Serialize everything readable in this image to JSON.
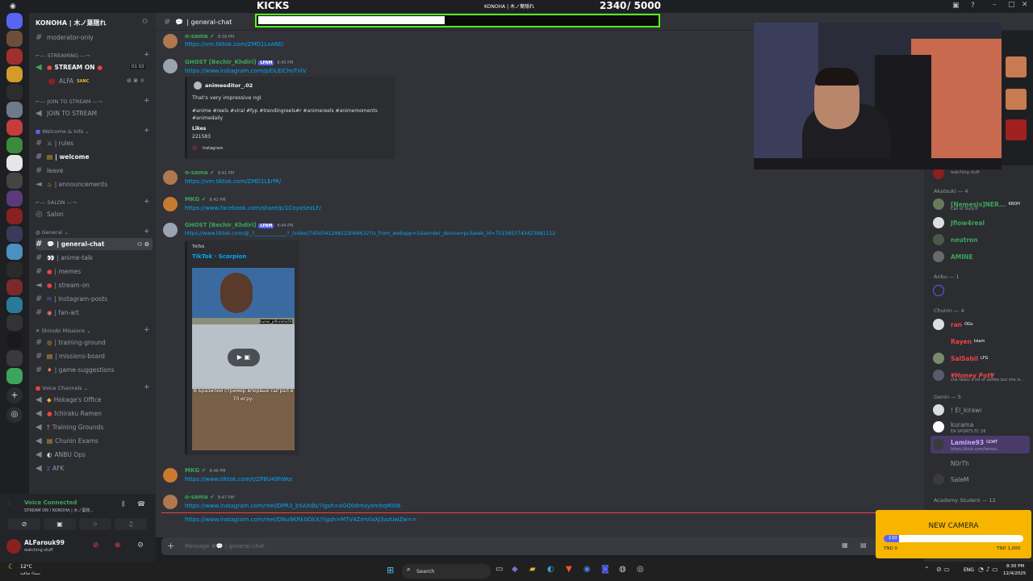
{
  "kicks_overlay": {
    "title": "KICKS",
    "server_tag": "KONOHA | 木ノ葉隠れ",
    "current": "2340",
    "goal": "/ 5000",
    "progress_fraction": 0.468
  },
  "server": {
    "name": "KONOHA | 木ノ葉隠れ"
  },
  "channels": {
    "top": "moderator-only",
    "streaming_cat": "STREAMING",
    "stream_on": "STREAM ON",
    "stream_users": "01  02",
    "stream_user": "ALFA",
    "stream_user_badge": "SANC",
    "join_cat": "JOIN TO STREAM",
    "join": "JOIN TO STREAM",
    "welcome_cat": "Welcome & Info",
    "rules": "| rules",
    "welcome": "| welcome",
    "leave": "leave",
    "announcements": "| announcements",
    "salon_cat": "SALON",
    "salon": "Salon",
    "general_cat": "General",
    "general_chat": "| general-chat",
    "anime_talk": "| anime-talk",
    "memes": "| memes",
    "stream_on_ch": "| stream-on",
    "instagram_posts": "| instagram-posts",
    "fan_art": "| fan-art",
    "shinobi_cat": "Shinobi Missions",
    "training_ground": "| training-ground",
    "missions_board": "| missions-board",
    "game_suggestions": "| game-suggestions",
    "voice_cat": "Voice Channels",
    "hokage": "Hokage's Office",
    "ichiraku": "Ichiraku Ramen",
    "training_grounds": "Training Grounds",
    "chunin_exams": "Chunin Exams",
    "anbu_ops": "ANBU Ops",
    "afk": "AFK"
  },
  "voice": {
    "status": "Voice Connected",
    "where": "STREAM ON / KONOHA | 木ノ葉隠...",
    "user": "ALFarouk99",
    "user_status": "watching stuff"
  },
  "chat": {
    "header": "| general-chat",
    "messages": [
      {
        "user": "o-sama",
        "time": "8:39 PM",
        "link": "https://vm.tiktok.com/ZMD1LxA6E/"
      },
      {
        "user": "GHOST [Bechir_Khdiri]",
        "tag": "LFAM",
        "time": "8:40 PM",
        "link": "https://www.instagram.com/p/DLEIChoTnlV"
      },
      {
        "user": "o-sama",
        "time": "8:41 PM",
        "link": "https://vm.tiktok.com/ZMD1LErfR/"
      },
      {
        "user": "MKG",
        "time": "8:42 PM",
        "link": "https://www.facebook.com/share/p/1CoyaSezLF/"
      },
      {
        "user": "GHOST [Bechir_Khdiri]",
        "tag": "LFAM",
        "time": "8:44 PM",
        "link": "https://www.tiktok.com/@_?_____________?_/video/7450541298123066632?is_from_webapp=1&sender_device=pc&web_id=7515853743423981112"
      },
      {
        "user": "MKG",
        "time": "8:46 PM",
        "link": "https://www.tiktok.com/t/ZP8U49hWo/"
      },
      {
        "user": "o-sama",
        "time": "8:47 PM",
        "link": "https://www.instagram.com/reel/DPR3_b5AXdb/?igsh=aGQ0dmxyemhqMXI6"
      },
      {
        "user": "",
        "time": "",
        "link": "https://www.instagram.com/reel/DNu9KRk0OXX/?igsh=MTV4ZmVlaXJ3azUwZw=="
      }
    ],
    "ig_embed": {
      "author": "animeeditor_.02",
      "text": "That's very impressive ngl",
      "tags": "#anime #reels #viral #fyp #trendingreels#r #animereels #animemoments #animedaily",
      "likes_label": "Likes",
      "likes": "221583",
      "source": "Instagram"
    },
    "tt_embed": {
      "provider": "TikTok",
      "title": "TikTok · Scorpion",
      "caption": "В Бразилии стример впервые сыграл в 70 игру:",
      "watermark": "humor_jefinzinho59"
    },
    "input_placeholder": "Message #💬 | general-chat"
  },
  "members": {
    "top_status": "watching stuff",
    "akatsuki_cat": "Akatsuki — 4",
    "akatsuki": [
      {
        "name": "[Nemesis]NER...",
        "status": "Call of Duty®",
        "color": "#3ba55d",
        "badge": "KRDH"
      },
      {
        "name": "Jflow4real",
        "status": "",
        "color": "#3ba55d"
      },
      {
        "name": "neutron",
        "status": "",
        "color": "#3ba55d"
      },
      {
        "name": "AMINE",
        "status": "",
        "color": "#3ba55d"
      }
    ],
    "anbu_cat": "Anbu — 1",
    "anbu": [
      {
        "name": "",
        "color": "#ed4245"
      }
    ],
    "chunin_cat": "Chunin — 4",
    "chunin": [
      {
        "name": "ran",
        "badge": "OGs",
        "color": "#ed4245"
      },
      {
        "name": "Rayen",
        "badge": "Islam",
        "color": "#ed4245"
      },
      {
        "name": "SalSabil",
        "badge": "LFG",
        "color": "#ed4245"
      },
      {
        "name": "¥Honey Pot¥",
        "status": "she takes a lot of selfies but she is...",
        "color": "#ed4245"
      }
    ],
    "genin_cat": "Genin — 5",
    "genin": [
      {
        "name": "! El_kirawi",
        "status": "",
        "color": "#949ba4"
      },
      {
        "name": "kurama",
        "status": "EA SPORTS FC 26",
        "color": "#949ba4"
      },
      {
        "name": "Lamine93",
        "badge": "GOAT",
        "status": "https://kick.com/lamoo...",
        "color": "#c9a8ff"
      },
      {
        "name": "N0rTh",
        "status": "",
        "color": "#949ba4"
      },
      {
        "name": "SaleM",
        "status": "",
        "color": "#949ba4"
      }
    ],
    "academy_cat": "Academy Student — 12"
  },
  "new_camera": {
    "title": "NEW CAMERA",
    "current": "110",
    "min": "TND 0",
    "max": "TND 1,000",
    "progress_fraction": 0.11
  },
  "taskbar": {
    "temp": "12°C",
    "weather": "سماء صافية",
    "search": "Search",
    "lang": "ENG",
    "time": "8:30 PM",
    "date": "12/4/2025"
  },
  "colors": {
    "discord_bg": "#313338",
    "link": "#00a8fc",
    "kick_green": "#53fc18",
    "camera_yellow": "#f7b500"
  }
}
